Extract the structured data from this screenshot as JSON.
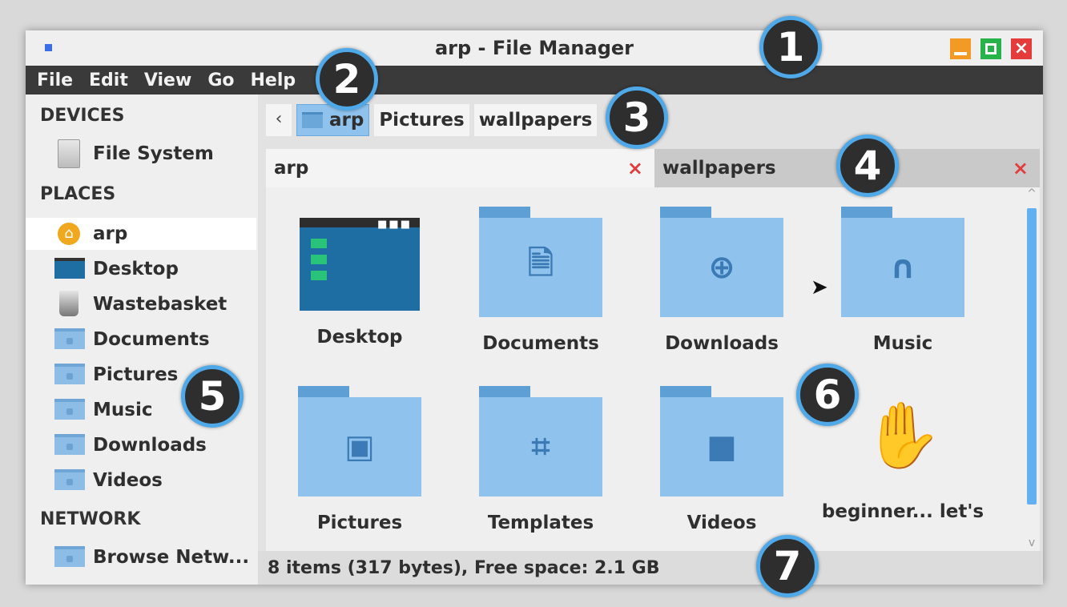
{
  "window": {
    "title": "arp - File Manager"
  },
  "menu": [
    "File",
    "Edit",
    "View",
    "Go",
    "Help"
  ],
  "sidebar": {
    "devices_header": "DEVICES",
    "devices": [
      {
        "label": "File System",
        "icon": "drive-icon"
      }
    ],
    "places_header": "PLACES",
    "places": [
      {
        "label": "arp",
        "icon": "home-icon"
      },
      {
        "label": "Desktop",
        "icon": "desktop-icon"
      },
      {
        "label": "Wastebasket",
        "icon": "trash-icon"
      },
      {
        "label": "Documents",
        "icon": "folder-icon"
      },
      {
        "label": "Pictures",
        "icon": "folder-icon"
      },
      {
        "label": "Music",
        "icon": "folder-icon"
      },
      {
        "label": "Downloads",
        "icon": "folder-icon"
      },
      {
        "label": "Videos",
        "icon": "folder-icon"
      }
    ],
    "network_header": "NETWORK",
    "network": [
      {
        "label": "Browse Netw...",
        "icon": "network-folder-icon"
      }
    ]
  },
  "pathbar": {
    "back": "‹",
    "segments": [
      "arp",
      "Pictures",
      "wallpapers"
    ]
  },
  "tabs": [
    {
      "label": "arp",
      "close": "×"
    },
    {
      "label": "wallpapers",
      "close": "×"
    }
  ],
  "items": [
    {
      "label": "Desktop",
      "icon": "desktop-icon"
    },
    {
      "label": "Documents",
      "icon": "document-folder-icon"
    },
    {
      "label": "Downloads",
      "icon": "download-folder-icon"
    },
    {
      "label": "Music",
      "icon": "music-folder-icon"
    },
    {
      "label": "Pictures",
      "icon": "pictures-folder-icon"
    },
    {
      "label": "Templates",
      "icon": "templates-folder-icon"
    },
    {
      "label": "Videos",
      "icon": "videos-folder-icon"
    },
    {
      "label": "beginner... let's",
      "icon": "hand-icon"
    }
  ],
  "status": "8 items (317 bytes), Free space: 2.1 GB",
  "callouts": [
    "1",
    "2",
    "3",
    "4",
    "5",
    "6",
    "7"
  ],
  "colors": {
    "accent": "#4fa8e8",
    "menubar": "#3a3a3a",
    "folder": "#8fc3ee",
    "close": "#e53b3b",
    "minimize": "#f39a25",
    "maximize": "#27b34a"
  }
}
